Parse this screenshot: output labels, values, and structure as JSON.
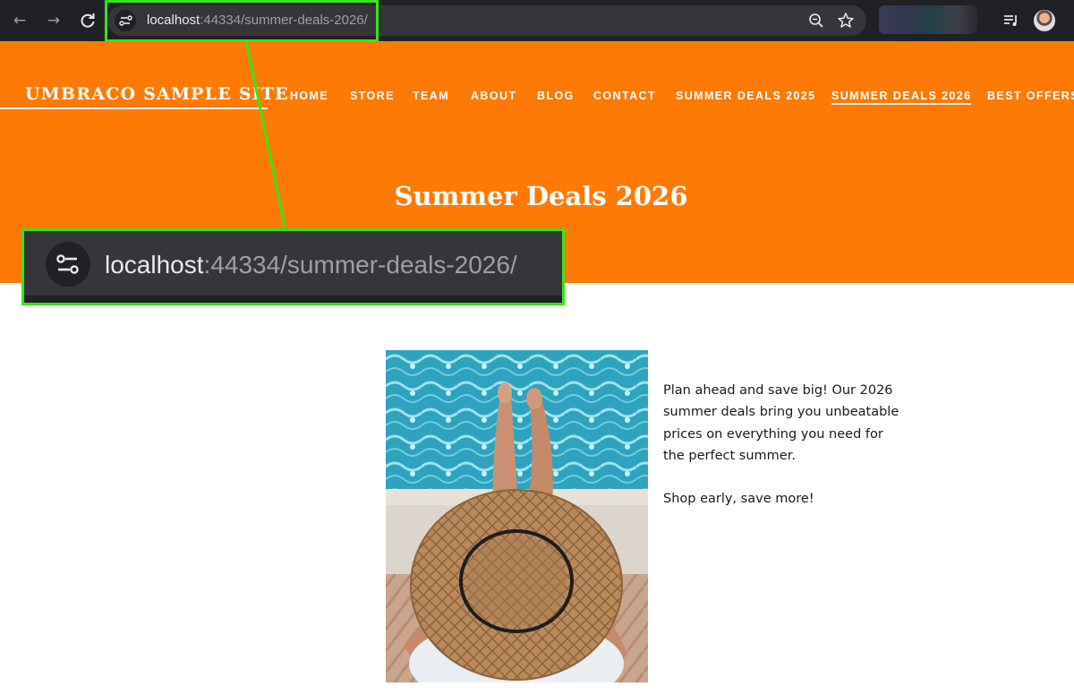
{
  "browser": {
    "url_host": "localhost",
    "url_rest": ":44334/summer-deals-2026/",
    "icons": [
      "back-arrow-icon",
      "forward-arrow-icon",
      "reload-icon",
      "site-settings-icon",
      "zoom-icon",
      "bookmark-star-icon",
      "media-control-icon",
      "profile-avatar"
    ]
  },
  "site": {
    "logo": "UMBRACO SAMPLE SITE",
    "nav": [
      "HOME",
      "STORE",
      "TEAM",
      "ABOUT",
      "BLOG",
      "CONTACT",
      "SUMMER DEALS 2025",
      "SUMMER DEALS 2026",
      "BEST OFFERS"
    ],
    "active_nav": "SUMMER DEALS 2026",
    "page_title": "Summer Deals 2026",
    "body_paragraph_1": "Plan ahead and save big! Our 2026 summer deals bring you unbeatable prices on everything you need for the perfect summer.",
    "body_paragraph_2": "Shop early, save more!"
  },
  "colors": {
    "header_orange": "#ff7a05",
    "highlight_green": "#34e617",
    "chrome_dark": "#202124"
  }
}
